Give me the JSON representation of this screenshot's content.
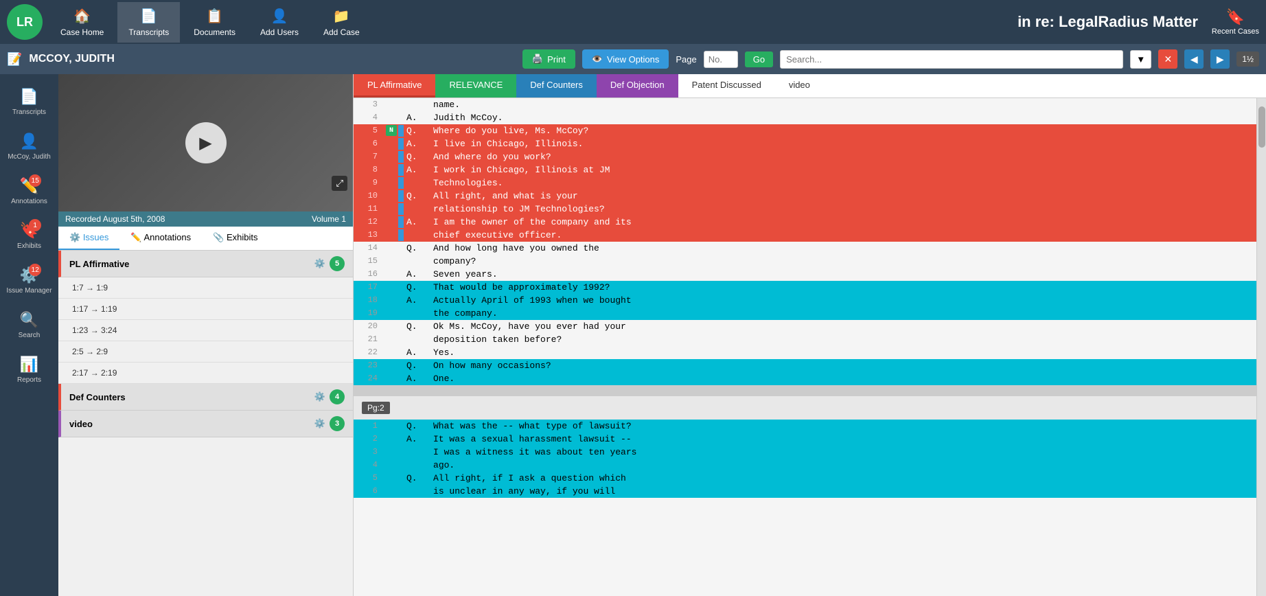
{
  "app": {
    "logo": "LR",
    "case_title": "in re: LegalRadius Matter"
  },
  "top_nav": {
    "items": [
      {
        "label": "Case Home",
        "icon": "🏠",
        "active": false
      },
      {
        "label": "Transcripts",
        "icon": "📄",
        "active": true
      },
      {
        "label": "Documents",
        "icon": "📋",
        "active": false
      },
      {
        "label": "Add Users",
        "icon": "👤",
        "active": false
      },
      {
        "label": "Add Case",
        "icon": "📁",
        "active": false
      }
    ],
    "recent_cases_label": "Recent Cases"
  },
  "second_toolbar": {
    "depo_name": "MCCOY, JUDITH",
    "print_label": "Print",
    "view_options_label": "View Options",
    "page_label": "Page",
    "go_label": "Go",
    "search_placeholder": "Search...",
    "page_num": "1½"
  },
  "sidebar": {
    "items": [
      {
        "label": "Transcripts",
        "icon": "📄",
        "badge": null
      },
      {
        "label": "McCoy, Judith",
        "icon": "👤",
        "badge": null
      },
      {
        "label": "Annotations",
        "icon": "✏️",
        "badge": 15
      },
      {
        "label": "Exhibits",
        "icon": "🔖",
        "badge": 1
      },
      {
        "label": "Issue Manager",
        "icon": "⚙️",
        "badge": 12
      },
      {
        "label": "Search",
        "icon": "🔍",
        "badge": null
      },
      {
        "label": "Reports",
        "icon": "📊",
        "badge": null
      }
    ]
  },
  "issues_panel": {
    "video_date": "Recorded August 5th, 2008",
    "volume": "Volume 1",
    "tabs": [
      {
        "label": "Issues",
        "active": true
      },
      {
        "label": "Annotations",
        "active": false
      },
      {
        "label": "Exhibits",
        "active": false
      }
    ],
    "groups": [
      {
        "label": "PL Affirmative",
        "type": "pl",
        "badge": 5,
        "items": [
          {
            "range": "1:7 → 1:9"
          },
          {
            "range": "1:17 → 1:19"
          },
          {
            "range": "1:23 → 3:24"
          },
          {
            "range": "2:5 → 2:9"
          },
          {
            "range": "2:17 → 2:19"
          }
        ]
      },
      {
        "label": "Def Counters",
        "type": "def",
        "badge": 4,
        "items": []
      },
      {
        "label": "video",
        "type": "vid",
        "badge": 3,
        "items": []
      }
    ]
  },
  "annotation_tabs": [
    {
      "label": "PL Affirmative",
      "style": "pl-aff"
    },
    {
      "label": "RELEVANCE",
      "style": "relevance"
    },
    {
      "label": "Def Counters",
      "style": "def-counters"
    },
    {
      "label": "Def Objection",
      "style": "def-obj"
    },
    {
      "label": "Patent Discussed",
      "style": "patent"
    },
    {
      "label": "video",
      "style": "video-tab"
    }
  ],
  "transcript": {
    "page1_lines": [
      {
        "num": 3,
        "speaker": "",
        "text": "     name.",
        "highlight": "none"
      },
      {
        "num": 4,
        "speaker": "A.",
        "text": "  Judith McCoy.",
        "highlight": "none"
      },
      {
        "num": 5,
        "speaker": "Q.",
        "text": "  Where do you live, Ms. McCoy?",
        "highlight": "red",
        "marker": "N"
      },
      {
        "num": 6,
        "speaker": "A.",
        "text": "  I live in Chicago, Illinois.",
        "highlight": "red"
      },
      {
        "num": 7,
        "speaker": "Q.",
        "text": "  And where do you work?",
        "highlight": "red"
      },
      {
        "num": 8,
        "speaker": "A.",
        "text": "  I work in Chicago, Illinois at JM",
        "highlight": "red"
      },
      {
        "num": 9,
        "speaker": "",
        "text": "     Technologies.",
        "highlight": "red"
      },
      {
        "num": 10,
        "speaker": "Q.",
        "text": "  All right, and what is your",
        "highlight": "red"
      },
      {
        "num": 11,
        "speaker": "",
        "text": "     relationship to JM Technologies?",
        "highlight": "red"
      },
      {
        "num": 12,
        "speaker": "A.",
        "text": "  I am the owner of the company and its",
        "highlight": "red"
      },
      {
        "num": 13,
        "speaker": "",
        "text": "     chief executive officer.",
        "highlight": "red"
      },
      {
        "num": 14,
        "speaker": "Q.",
        "text": "  And how long have you owned the",
        "highlight": "none"
      },
      {
        "num": 15,
        "speaker": "",
        "text": "     company?",
        "highlight": "none"
      },
      {
        "num": 16,
        "speaker": "A.",
        "text": "  Seven years.",
        "highlight": "none"
      },
      {
        "num": 17,
        "speaker": "Q.",
        "text": "  That would be approximately 1992?",
        "highlight": "cyan"
      },
      {
        "num": 18,
        "speaker": "A.",
        "text": "  Actually April of 1993 when we bought",
        "highlight": "cyan"
      },
      {
        "num": 19,
        "speaker": "",
        "text": "     the company.",
        "highlight": "cyan"
      },
      {
        "num": 20,
        "speaker": "Q.",
        "text": "  Ok Ms. McCoy, have you ever had your",
        "highlight": "none"
      },
      {
        "num": 21,
        "speaker": "",
        "text": "     deposition taken before?",
        "highlight": "none"
      },
      {
        "num": 22,
        "speaker": "A.",
        "text": "  Yes.",
        "highlight": "none"
      },
      {
        "num": 23,
        "speaker": "Q.",
        "text": "  On how many occasions?",
        "highlight": "cyan"
      },
      {
        "num": 24,
        "speaker": "A.",
        "text": "  One.",
        "highlight": "cyan"
      }
    ],
    "page2_lines": [
      {
        "num": 1,
        "speaker": "Q.",
        "text": "  What was the -- what type of lawsuit?",
        "highlight": "cyan"
      },
      {
        "num": 2,
        "speaker": "A.",
        "text": "  It was a sexual harassment lawsuit --",
        "highlight": "cyan"
      },
      {
        "num": 3,
        "speaker": "",
        "text": "     I was a witness it was about ten years",
        "highlight": "cyan"
      },
      {
        "num": 4,
        "speaker": "",
        "text": "     ago.",
        "highlight": "cyan"
      },
      {
        "num": 5,
        "speaker": "Q.",
        "text": "  All right, if I ask a question which",
        "highlight": "cyan"
      },
      {
        "num": 6,
        "speaker": "",
        "text": "     is unclear in any way, if you will",
        "highlight": "cyan"
      }
    ]
  }
}
